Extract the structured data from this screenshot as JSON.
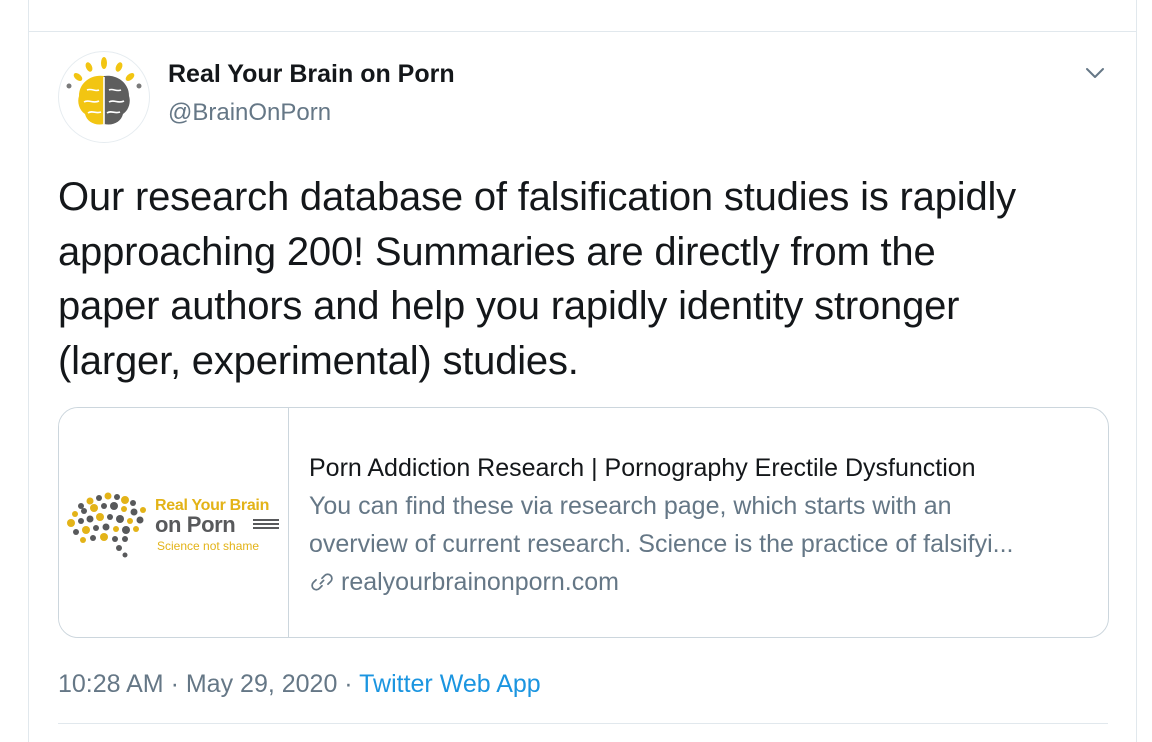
{
  "author": {
    "display_name": "Real Your Brain on Porn",
    "handle": "@BrainOnPorn"
  },
  "tweet": {
    "text": "Our research database of falsification studies is rapidly\napproaching 200! Summaries are directly from the\npaper authors and help you rapidly identity stronger\n(larger, experimental) studies."
  },
  "card": {
    "logo": {
      "line1": "Real Your Brain",
      "line2": "on Porn",
      "line3": "Science not shame"
    },
    "title": "Porn Addiction Research | Pornography Erectile Dysfunction",
    "description_lines": [
      "You can find these via research page, which starts with an",
      "overview of current research. Science is the practice of falsifyi..."
    ],
    "domain": "realyourbrainonporn.com"
  },
  "meta": {
    "time": "10:28 AM",
    "separator": " · ",
    "date": "May 29, 2020",
    "source": "Twitter Web App"
  },
  "icons": {
    "more": "chevron-down-icon",
    "link": "link-icon"
  },
  "colors": {
    "text_primary": "#14171a",
    "text_secondary": "#657786",
    "link": "#1b95e0",
    "border": "#ccd6dd",
    "brand_yellow": "#e3b318",
    "brand_gray": "#58595b"
  }
}
